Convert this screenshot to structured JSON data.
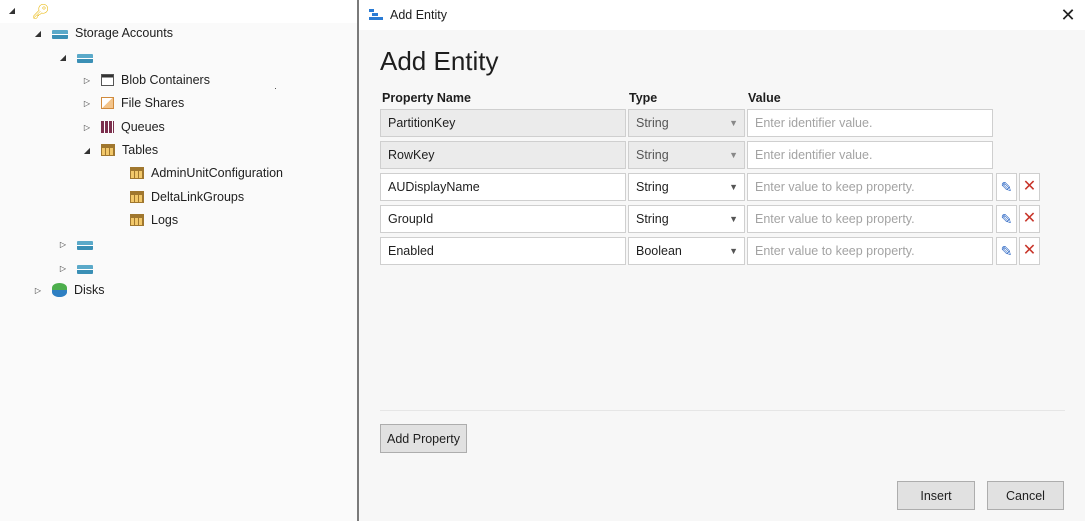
{
  "tree": {
    "storage_accounts_label": "Storage Accounts",
    "blob_containers_label": "Blob Containers",
    "file_shares_label": "File Shares",
    "queues_label": "Queues",
    "tables_label": "Tables",
    "tables": [
      "AdminUnitConfiguration",
      "DeltaLinkGroups",
      "Logs"
    ],
    "disks_label": "Disks"
  },
  "dialog": {
    "window_title": "Add Entity",
    "heading": "Add Entity",
    "columns": {
      "property_name": "Property Name",
      "type": "Type",
      "value": "Value"
    },
    "rows": [
      {
        "name": "PartitionKey",
        "type": "String",
        "value_placeholder": "Enter identifier value.",
        "editable": false
      },
      {
        "name": "RowKey",
        "type": "String",
        "value_placeholder": "Enter identifier value.",
        "editable": false
      },
      {
        "name": "AUDisplayName",
        "type": "String",
        "value_placeholder": "Enter value to keep property.",
        "editable": true
      },
      {
        "name": "GroupId",
        "type": "String",
        "value_placeholder": "Enter value to keep property.",
        "editable": true
      },
      {
        "name": "Enabled",
        "type": "Boolean",
        "value_placeholder": "Enter value to keep property.",
        "editable": true
      }
    ],
    "add_property_label": "Add Property",
    "insert_label": "Insert",
    "cancel_label": "Cancel"
  },
  "icons": {
    "key": "key-icon",
    "storage": "storage-account-icon",
    "blob": "blob-container-icon",
    "share": "file-share-icon",
    "queue": "queue-icon",
    "table": "table-icon",
    "disk": "disk-icon",
    "edit": "pencil-icon",
    "delete": "close-icon"
  },
  "colors": {
    "accent": "#2a7bd4",
    "delete": "#c8352a",
    "edit": "#2c67c4"
  }
}
